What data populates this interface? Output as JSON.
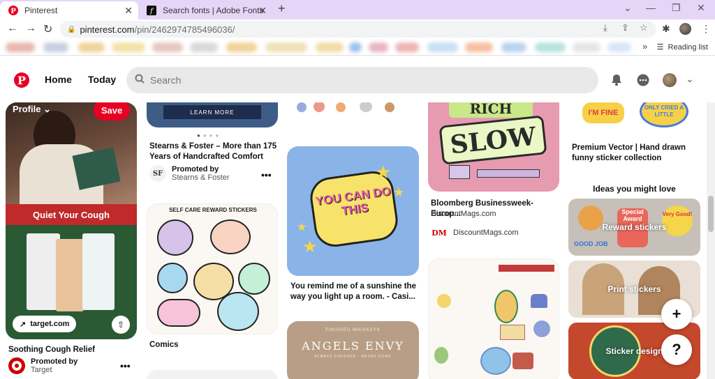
{
  "browser": {
    "tabs": [
      {
        "title": "Pinterest"
      },
      {
        "title": "Search fonts | Adobe Fonts"
      }
    ],
    "url_host": "pinterest.com",
    "url_path": "/pin/2462974785496036/",
    "reading_list": "Reading list"
  },
  "header": {
    "home": "Home",
    "today": "Today",
    "search_placeholder": "Search"
  },
  "col1": {
    "profile_label": "Profile",
    "save_label": "Save",
    "banner_text": "Quiet Your Cough",
    "link_chip": "target.com",
    "title": "Soothing Cough Relief",
    "promoted": "Promoted by",
    "advertiser": "Target"
  },
  "col2": {
    "learn_more": "LEARN MORE",
    "title": "Stearns & Foster – More than 175 Years of Handcrafted Comfort",
    "promoted": "Promoted by",
    "advertiser": "Stearns & Foster",
    "advertiser_logo": "SF",
    "sticker_heading": "SELF CARE REWARD STICKERS",
    "comics_title": "Comics"
  },
  "col3": {
    "sticker_text": "YOU CAN DO THIS",
    "title": "You remind me of a sunshine the way you light up a room. - Casi...",
    "angels_top": "FINISHED WHISKEYS",
    "angels_title": "ANGELS ENVY",
    "angels_sub": "ALWAYS FINISHED · NEVER DONE"
  },
  "col4": {
    "art_top": "RICH",
    "art_bottom": "SLOW",
    "title": "Bloomberg Businessweek-Europ...",
    "domain": "DiscountMags.com",
    "source_logo": "DM",
    "source": "DiscountMags.com"
  },
  "col5": {
    "sticker_a": "I'M FINE",
    "sticker_b": "ONLY CRIED A LITTLE",
    "title": "Premium Vector | Hand drawn funny sticker collection",
    "ideas_heading": "Ideas you might love",
    "ideas": [
      {
        "label": "Reward stickers"
      },
      {
        "label": "Print stickers"
      },
      {
        "label": "Sticker design"
      }
    ],
    "reward_badges": [
      "GOOD JOB",
      "Special Award",
      "Very Good!"
    ]
  },
  "fab": {
    "add": "+",
    "help": "?"
  },
  "colors": {
    "brand": "#e60023",
    "tabstrip": "#e5d6f7"
  }
}
